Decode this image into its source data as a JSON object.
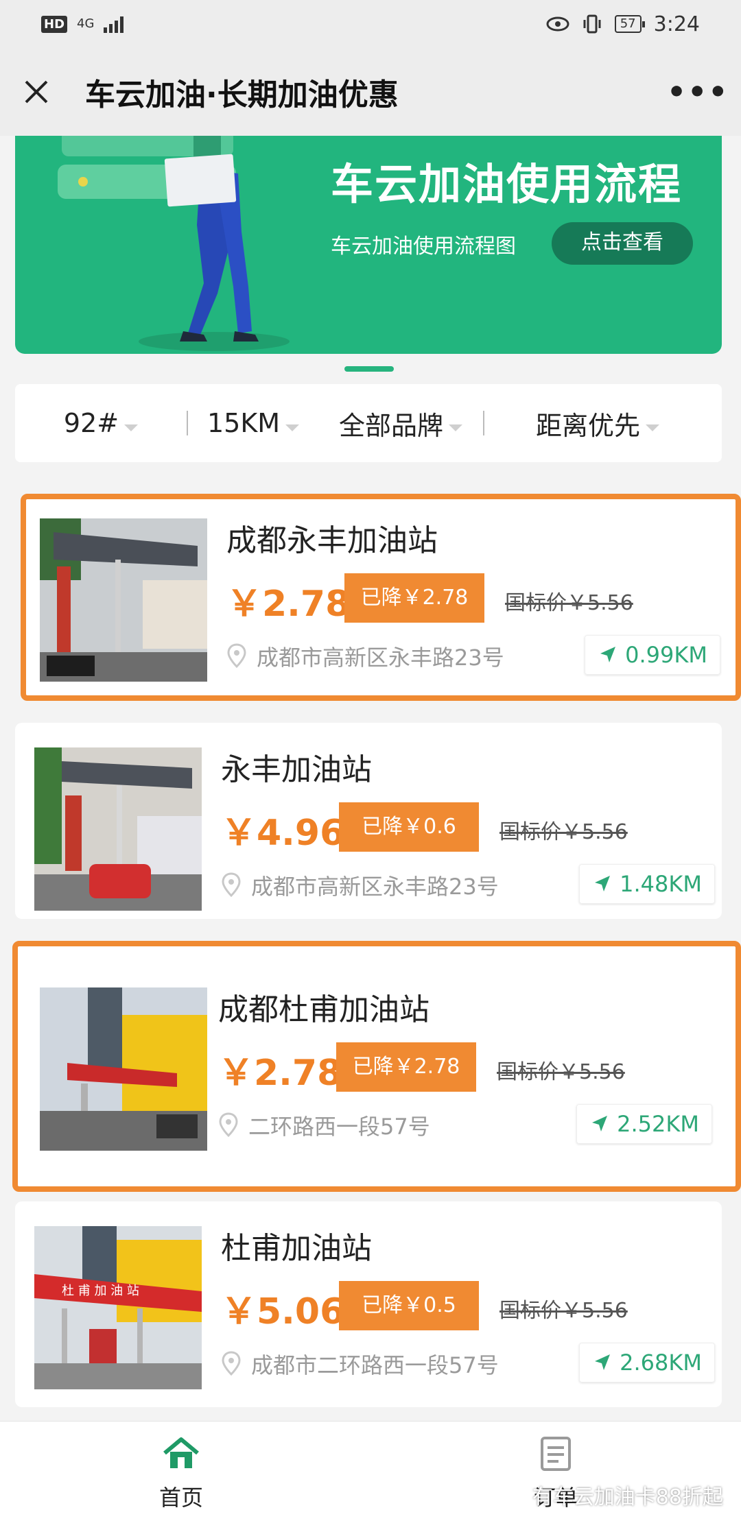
{
  "status_bar": {
    "hd": "HD",
    "network": "4G",
    "battery": "57",
    "time": "3:24"
  },
  "title_bar": {
    "close_icon": "close-icon",
    "title": "车云加油·长期加油优惠",
    "more_label": "•••"
  },
  "banner": {
    "title": "车云加油使用流程",
    "subtitle": "车云加油使用流程图",
    "button_label": "点击查看",
    "color": "#22b57e"
  },
  "filters": {
    "fuel": "92#",
    "range": "15KM",
    "brand": "全部品牌",
    "sort": "距离优先"
  },
  "stations": [
    {
      "name": "成都永丰加油站",
      "price": "￥2.78",
      "discount": "已降￥2.78",
      "standard_price": "国标价￥5.56",
      "address": "成都市高新区永丰路23号",
      "distance": "0.99KM",
      "highlighted": true
    },
    {
      "name": "永丰加油站",
      "price": "￥4.96",
      "discount": "已降￥0.6",
      "standard_price": "国标价￥5.56",
      "address": "成都市高新区永丰路23号",
      "distance": "1.48KM",
      "highlighted": false
    },
    {
      "name": "成都杜甫加油站",
      "price": "￥2.78",
      "discount": "已降￥2.78",
      "standard_price": "国标价￥5.56",
      "address": "二环路西一段57号",
      "distance": "2.52KM",
      "highlighted": true
    },
    {
      "name": "杜甫加油站",
      "price": "￥5.06",
      "discount": "已降￥0.5",
      "standard_price": "国标价￥5.56",
      "address": "成都市二环路西一段57号",
      "distance": "2.68KM",
      "highlighted": false
    }
  ],
  "station_sign_text": "杜 甫 加 油 站",
  "tab_bar": {
    "home_label": "首页",
    "orders_label": "订单"
  },
  "watermark": "有车云加油卡88折起",
  "colors": {
    "accent_orange": "#f08a32",
    "price_orange": "#ef8126",
    "green": "#2da777"
  }
}
